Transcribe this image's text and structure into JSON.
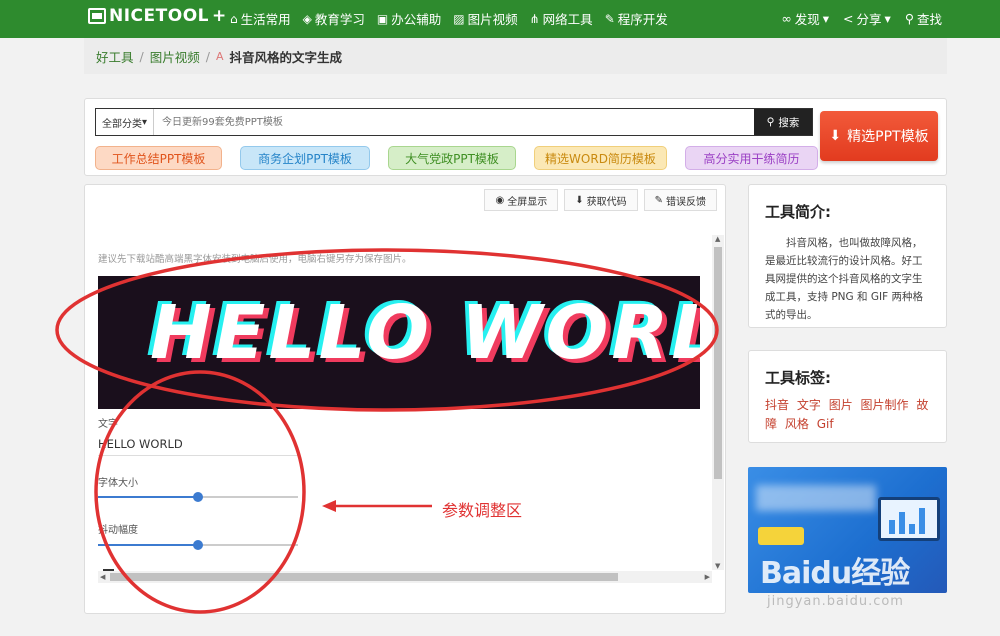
{
  "nav": {
    "logo": "NICETOOL",
    "items": [
      {
        "icon": "home-icon",
        "label": "生活常用"
      },
      {
        "icon": "graduation-icon",
        "label": "教育学习"
      },
      {
        "icon": "briefcase-icon",
        "label": "办公辅助"
      },
      {
        "icon": "image-icon",
        "label": "图片视频"
      },
      {
        "icon": "network-icon",
        "label": "网络工具"
      },
      {
        "icon": "wrench-icon",
        "label": "程序开发"
      }
    ],
    "right": [
      {
        "icon": "glasses-icon",
        "label": "发现"
      },
      {
        "icon": "share-icon",
        "label": "分享"
      },
      {
        "icon": "search-icon",
        "label": "查找"
      }
    ]
  },
  "breadcrumb": {
    "home": "好工具",
    "category": "图片视频",
    "current": "抖音风格的文字生成"
  },
  "search": {
    "category": "全部分类",
    "placeholder": "今日更新99套免费PPT模板",
    "button": "搜索",
    "ppt_button": "精选PPT模板"
  },
  "tags": [
    "工作总结PPT模板",
    "商务企划PPT模板",
    "大气党政PPT模板",
    "精选WORD简历模板",
    "高分实用干练简历"
  ],
  "toolbar": {
    "fullscreen": "全屏显示",
    "get_code": "获取代码",
    "feedback": "错误反馈"
  },
  "tool": {
    "hint": "建议先下载站酷高端黑字体安装到电脑后使用，电脑右键另存为保存图片。",
    "canvas_text": "HELLO WORLD",
    "text_label": "文字",
    "text_value": "HELLO WORLD",
    "size_label": "字体大小",
    "size_value": 0.5,
    "shake_label": "抖动幅度",
    "shake_value": 0.5
  },
  "sidebar": {
    "intro_title": "工具简介:",
    "intro_body": "抖音风格，也叫做故障风格，是最近比较流行的设计风格。好工具网提供的这个抖音风格的文字生成工具，支持 PNG 和 GIF 两种格式的导出。",
    "tags_title": "工具标签:",
    "tags": [
      "抖音",
      "文字",
      "图片",
      "图片制作",
      "故障",
      "风格",
      "Gif"
    ]
  },
  "annotation": {
    "label": "参数调整区",
    "color": "#e03232"
  },
  "watermark": {
    "brand": "Baidu经验",
    "url": "jingyan.baidu.com"
  },
  "colors": {
    "nav_bg": "#2e8b2e",
    "accent_red": "#e23b1f",
    "glitch_cyan": "#26f0f0",
    "glitch_magenta": "#f03b5e"
  }
}
